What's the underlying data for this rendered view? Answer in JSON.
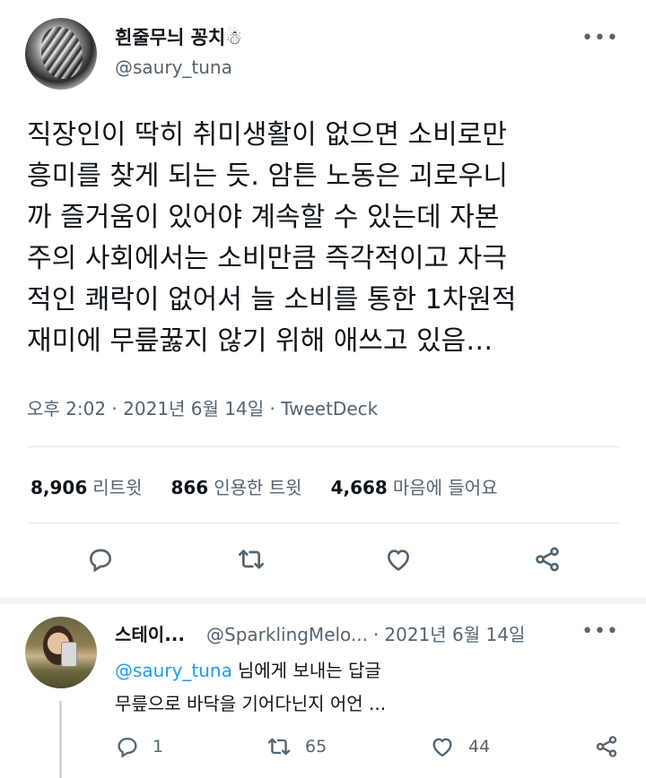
{
  "tweet": {
    "display_name": "흰줄무늬 꽁치☃",
    "handle": "@saury_tuna",
    "more_icon": "more-horizontal-icon",
    "text": "직장인이 딱히 취미생활이 없으면 소비로만\n흥미를 찾게 되는 듯. 암튼 노동은 괴로우니\n까 즐거움이 있어야 계속할 수 있는데 자본\n주의 사회에서는 소비만큼 즉각적이고 자극\n적인 쾌락이 없어서 늘 소비를 통한 1차원적\n재미에 무릎꿇지 않기 위해 애쓰고 있음…",
    "timestamp": "오후 2:02 · 2021년 6월 14일 · TweetDeck",
    "stats": {
      "retweets_count": "8,906",
      "retweets_label": "리트윗",
      "quotes_count": "866",
      "quotes_label": "인용한 트윗",
      "likes_count": "4,668",
      "likes_label": "마음에 들어요"
    }
  },
  "reply": {
    "display_name": "스테이...",
    "handle": "@SparklingMelo...",
    "separator": "·",
    "time": "2021년 6월 14일",
    "reply_to_handle": "@saury_tuna",
    "reply_to_suffix": "님에게 보내는 답글",
    "text": "무릎으로 바닥을 기어다닌지 어언 ...",
    "reply_count": "1",
    "retweet_count": "65",
    "like_count": "44"
  },
  "colors": {
    "text": "#0f1419",
    "secondary": "#536471",
    "accent": "#1d9bf0",
    "divider": "#e3e7ea"
  }
}
